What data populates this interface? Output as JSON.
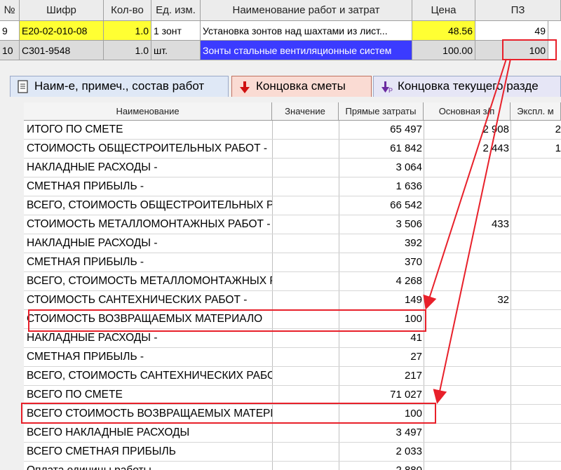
{
  "top_grid": {
    "headers": [
      "№",
      "Шифр",
      "Кол-во",
      "Ед. изм.",
      "Наименование работ и затрат",
      "Цена",
      "ПЗ"
    ],
    "rows": [
      {
        "num": "9",
        "code": "E20-02-010-08",
        "qty": "1.0",
        "unit": "1 зонт",
        "name": "Установка зонтов над шахтами из лист...",
        "price": "48.56",
        "pz": "49"
      },
      {
        "num": "10",
        "code": "C301-9548",
        "qty": "1.0",
        "unit": "шт.",
        "name": "Зонты стальные вентиляционные систем",
        "price": "100.00",
        "pz": "100"
      }
    ]
  },
  "tabs": [
    {
      "label": "Наим-е, примеч., состав работ",
      "icon": "document-icon"
    },
    {
      "label": "Концовка сметы",
      "icon": "red-down-arrow-icon"
    },
    {
      "label": "Концовка текущего разде",
      "icon": "purple-down-arrow-icon"
    }
  ],
  "table": {
    "headers": [
      "Наименование",
      "Значение",
      "Прямые затраты",
      "Основная з/п",
      "Экспл. м"
    ],
    "rows": [
      {
        "name": "  ИТОГО ПО СМЕТЕ",
        "pz": "65 497",
        "oz": "2 908",
        "ek": "2"
      },
      {
        "name": "СТОИМОСТЬ ОБЩЕСТРОИТЕЛЬНЫХ РАБОТ -",
        "pz": "61 842",
        "oz": "2 443",
        "ek": "1"
      },
      {
        "name": "  НАКЛАДНЫЕ РАСХОДЫ -",
        "pz": "3 064",
        "oz": "",
        "ek": ""
      },
      {
        "name": "  СМЕТНАЯ ПРИБЫЛЬ -",
        "pz": "1 636",
        "oz": "",
        "ek": ""
      },
      {
        "name": "ВСЕГО, СТОИМОСТЬ ОБЩЕСТРОИТЕЛЬНЫХ РА",
        "pz": "66 542",
        "oz": "",
        "ek": ""
      },
      {
        "name": "СТОИМОСТЬ МЕТАЛЛОМОНТАЖНЫХ РАБОТ -",
        "pz": "3 506",
        "oz": "433",
        "ek": ""
      },
      {
        "name": "  НАКЛАДНЫЕ РАСХОДЫ -",
        "pz": "392",
        "oz": "",
        "ek": ""
      },
      {
        "name": "  СМЕТНАЯ ПРИБЫЛЬ -",
        "pz": "370",
        "oz": "",
        "ek": ""
      },
      {
        "name": "ВСЕГО, СТОИМОСТЬ МЕТАЛЛОМОНТАЖНЫХ Р",
        "pz": "4 268",
        "oz": "",
        "ek": ""
      },
      {
        "name": "СТОИМОСТЬ САНТЕХНИЧЕСКИХ РАБОТ -",
        "pz": "149",
        "oz": "32",
        "ek": ""
      },
      {
        "name": "  СТОИМОСТЬ ВОЗВРАЩАЕМЫХ МАТЕРИАЛО",
        "pz": "100",
        "oz": "",
        "ek": ""
      },
      {
        "name": "  НАКЛАДНЫЕ РАСХОДЫ -",
        "pz": "41",
        "oz": "",
        "ek": ""
      },
      {
        "name": "  СМЕТНАЯ ПРИБЫЛЬ -",
        "pz": "27",
        "oz": "",
        "ek": ""
      },
      {
        "name": "ВСЕГО, СТОИМОСТЬ САНТЕХНИЧЕСКИХ РАБО",
        "pz": "217",
        "oz": "",
        "ek": ""
      },
      {
        "name": " ВСЕГО ПО СМЕТЕ",
        "pz": "71 027",
        "oz": "",
        "ek": ""
      },
      {
        "name": "ВСЕГО СТОИМОСТЬ ВОЗВРАЩАЕМЫХ МАТЕРИ",
        "pz": "100",
        "oz": "",
        "ek": ""
      },
      {
        "name": "ВСЕГО НАКЛАДНЫЕ РАСХОДЫ",
        "pz": "3 497",
        "oz": "",
        "ek": ""
      },
      {
        "name": "ВСЕГО СМЕТНАЯ ПРИБЫЛЬ",
        "pz": "2 033",
        "oz": "",
        "ek": ""
      },
      {
        "name": "Оплата единицы работы",
        "pz": "2 880",
        "oz": "",
        "ek": ""
      }
    ]
  },
  "colors": {
    "highlight_yellow": "#ffff33",
    "selection_blue": "#3b3bff",
    "annotation_red": "#e8202a"
  }
}
